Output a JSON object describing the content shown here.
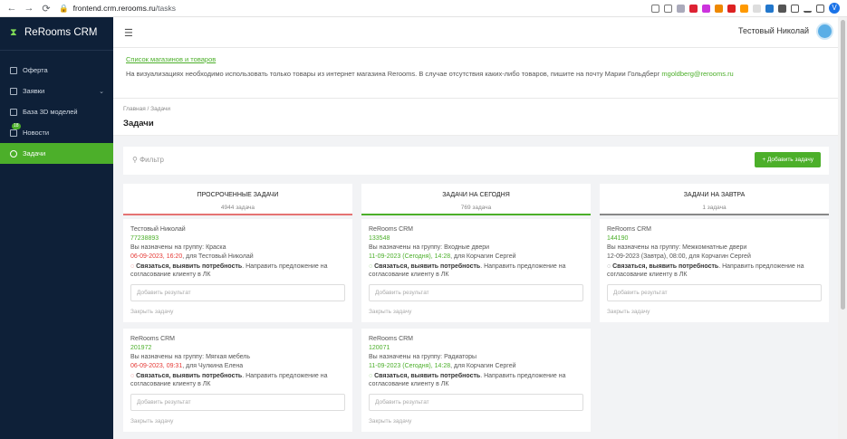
{
  "browser": {
    "url_host": "frontend.crm.rerooms.ru",
    "url_path": "/tasks",
    "profile": "V"
  },
  "app": {
    "name": "ReRooms CRM"
  },
  "sidebar": {
    "items": [
      {
        "label": "Оферта"
      },
      {
        "label": "Заявки"
      },
      {
        "label": "База 3D моделей"
      },
      {
        "label": "Новости",
        "badge": "18"
      },
      {
        "label": "Задачи"
      }
    ]
  },
  "topbar": {
    "user": "Тестовый Николай"
  },
  "info": {
    "link": "Список магазинов и товаров",
    "text": "На визуализациях необходимо использовать только товары из интернет магазина Rerooms. В случае отсутствия каких-либо товаров, пишите на почту Марии Гольдберг ",
    "email": "mgoldberg@rerooms.ru"
  },
  "breadcrumb": {
    "home": "Главная",
    "sep": " / ",
    "current": "Задачи"
  },
  "page": {
    "title": "Задачи"
  },
  "filter": {
    "placeholder": "Фильтр",
    "add_label": "+ Добавить задачу"
  },
  "columns": [
    {
      "title": "ПРОСРОЧЕННЫЕ ЗАДАЧИ",
      "count": "4944 задача",
      "color": "#e57373"
    },
    {
      "title": "ЗАДАЧИ НА СЕГОДНЯ",
      "count": "769 задача",
      "color": "#4caf2a"
    },
    {
      "title": "ЗАДАЧИ НА ЗАВТРА",
      "count": "1 задача",
      "color": "#888888"
    }
  ],
  "cards": [
    {
      "author": "Тестовый Николай",
      "id": "77238893",
      "group": "Вы назначены на группу: Краска",
      "date": "06-09-2023, 16:20",
      "for": ", для Тестовый Николай",
      "action": "Связаться, выявить потребность",
      "desc": ". Направить предложение на согласование клиенту в ЛК",
      "result": "Добавить результат",
      "close": "Закрыть задачу"
    },
    {
      "author": "ReRooms CRM",
      "id": "133548",
      "group": "Вы назначены на группу: Входные двери",
      "date": "11-09-2023 (Сегодня), 14:28",
      "for": ", для Корчагин Сергей",
      "action": "Связаться, выявить потребность",
      "desc": ". Направить предложение на согласование клиенту в ЛК",
      "result": "Добавить результат",
      "close": "Закрыть задачу"
    },
    {
      "author": "ReRooms CRM",
      "id": "144190",
      "group": "Вы назначены на группу: Межкомнатные двери",
      "date": "12-09-2023 (Завтра), 08:00",
      "for": ", для Корчагин Сергей",
      "action": "Связаться, выявить потребность",
      "desc": ". Направить предложение на согласование клиенту в ЛК",
      "result": "Добавить результат",
      "close": "Закрыть задачу"
    },
    {
      "author": "ReRooms CRM",
      "id": "201972",
      "group": "Вы назначены на группу: Мягкая мебель",
      "date": "06-09-2023, 09:31",
      "for": ", для Чулкина Елена",
      "action": "Связаться, выявить потребность",
      "desc": ". Направить предложение на согласование клиенту в ЛК",
      "result": "Добавить результат",
      "close": "Закрыть задачу"
    },
    {
      "author": "ReRooms CRM",
      "id": "120071",
      "group": "Вы назначены на группу: Радиаторы",
      "date": "11-09-2023 (Сегодня), 14:28",
      "for": ", для Корчагин Сергей",
      "action": "Связаться, выявить потребность",
      "desc": ". Направить предложение на согласование клиенту в ЛК",
      "result": "Добавить результат",
      "close": "Закрыть задачу"
    }
  ],
  "colors": {
    "accent": "#4caf2a",
    "sidebar": "#0e2038",
    "overdue": "#e53935"
  }
}
